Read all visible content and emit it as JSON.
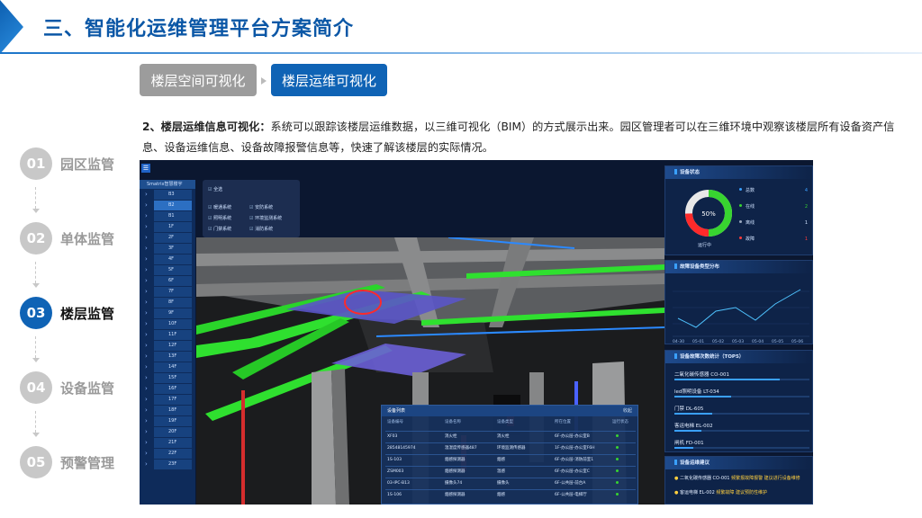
{
  "header": {
    "title": "三、智能化运维管理平台方案简介"
  },
  "tabs": [
    {
      "label": "楼层空间可视化",
      "active": false
    },
    {
      "label": "楼层运维可视化",
      "active": true
    }
  ],
  "description": {
    "lead": "2、楼层运维信息可视化：",
    "body": "系统可以跟踪该楼层运维数据，以三维可视化（BIM）的方式展示出来。园区管理者可以在三维环境中观察该楼层所有设备资产信息、设备运维信息、设备故障报警信息等，快速了解该楼层的实际情况。"
  },
  "steps": [
    {
      "num": "01",
      "label": "园区监管",
      "active": false
    },
    {
      "num": "02",
      "label": "单体监管",
      "active": false
    },
    {
      "num": "03",
      "label": "楼层监管",
      "active": true
    },
    {
      "num": "04",
      "label": "设备监管",
      "active": false
    },
    {
      "num": "05",
      "label": "预警管理",
      "active": false
    }
  ],
  "app": {
    "floor_nav": {
      "header": "Smatrix智慧楼宇",
      "floors": [
        "B3",
        "B2",
        "B1",
        "1F",
        "2F",
        "3F",
        "4F",
        "5F",
        "6F",
        "7F",
        "8F",
        "9F",
        "10F",
        "11F",
        "12F",
        "13F",
        "14F",
        "15F",
        "16F",
        "17F",
        "18F",
        "19F",
        "20F",
        "21F",
        "22F",
        "23F"
      ],
      "selected": "B2"
    },
    "systems": {
      "all": "全选",
      "items": [
        "暖通系统",
        "安防系统",
        "照明系统",
        "环境监测系统",
        "门禁系统",
        "消防系统"
      ]
    },
    "device_status": {
      "title": "设备状态",
      "percent": "50%",
      "caption": "运行中",
      "stats": [
        {
          "label": "总数",
          "value": "4",
          "color": "#3aa0ff"
        },
        {
          "label": "在线",
          "value": "2",
          "color": "#38d430"
        },
        {
          "label": "离线",
          "value": "1",
          "color": "#9aa8bf"
        },
        {
          "label": "故障",
          "value": "1",
          "color": "#ff3b3b"
        }
      ]
    },
    "fault_trend": {
      "title": "故障设备类型分布",
      "x": [
        "04-30",
        "05-01",
        "05-02",
        "05-03",
        "05-04",
        "05-05",
        "05-06"
      ]
    },
    "fault_rank": {
      "title": "设备故障次数统计（TOP5）",
      "rows": [
        {
          "label": "二氧化碳传感器 CO-001",
          "pct": 0.78
        },
        {
          "label": "led照明设备 LT-034",
          "pct": 0.42
        },
        {
          "label": "门禁 DL-605",
          "pct": 0.28
        },
        {
          "label": "客运电梯 EL-002",
          "pct": 0.2
        },
        {
          "label": "闸机 FD-001",
          "pct": 0.14
        }
      ]
    },
    "suggestions": {
      "title": "设备运维建议",
      "rows": [
        {
          "device": "二氧化碳传感器 CO-001",
          "note": "频繁报故障报警 建议进行设备维修"
        },
        {
          "device": "客运电梯 EL-002",
          "note": "频繁故障 建议预防性维护"
        }
      ]
    },
    "device_list": {
      "title": "设备列表",
      "close": "收起",
      "columns": [
        "设备编号",
        "设备名称",
        "设备类型",
        "所在位置",
        "运行状态"
      ],
      "rows": [
        [
          "XF03",
          "消火栓",
          "消火栓",
          "6F-办公层-办公室B"
        ],
        [
          "28548145974",
          "温湿度传感器487",
          "环境监测传感器",
          "1F-办公层-办公室F6H"
        ],
        [
          "1S-103",
          "烟感探测器",
          "烟感",
          "6F-办公层-消防前室1"
        ],
        [
          "ZSM003",
          "烟感探测器",
          "温感",
          "6F-办公层-办公室C"
        ],
        [
          "03-IPC-B13",
          "摄像头74",
          "摄像头",
          "6F-公共层-前台A"
        ],
        [
          "1S-106",
          "烟感探测器",
          "烟感",
          "6F-公共层-电梯厅"
        ]
      ]
    }
  }
}
